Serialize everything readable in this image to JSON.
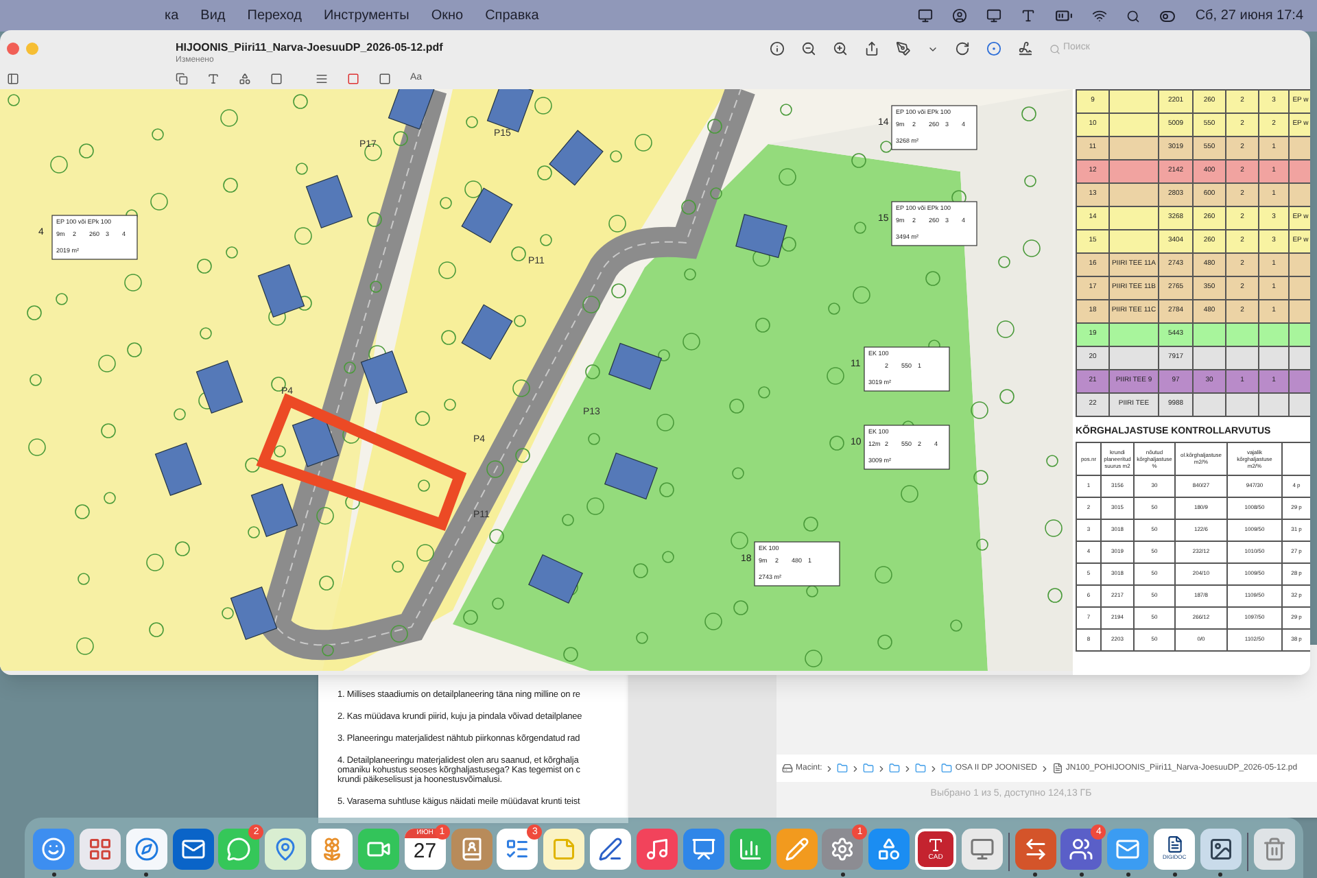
{
  "menu_bar": {
    "menus": [
      "ка",
      "Вид",
      "Переход",
      "Инструменты",
      "Окно",
      "Справка"
    ],
    "clock": "Сб, 27 июня 17:4"
  },
  "preview_window": {
    "title": "HIJOONIS_Piiri11_Narva-JoesuuDP_2026-05-12.pdf",
    "subtitle": "Изменено",
    "search": {
      "placeholder": "Поиск"
    },
    "font_button": "Aa",
    "map": {
      "plot_labels": [
        "P17",
        "P15",
        "P11",
        "P13",
        "P4",
        "P4",
        "P11"
      ],
      "lot_boxes": [
        {
          "num": "4",
          "header": "EP 100 või EPk 100",
          "cells": [
            "9m",
            "2",
            "260",
            "3",
            "4"
          ],
          "area": "2019 m²"
        },
        {
          "num": "14",
          "header": "EP 100 või EPk 100",
          "cells": [
            "9m",
            "2",
            "260",
            "3",
            "4"
          ],
          "area": "3268 m²"
        },
        {
          "num": "15",
          "header": "EP 100 või EPk 100",
          "cells": [
            "9m",
            "2",
            "260",
            "3",
            "4"
          ],
          "area": "3494 m²"
        },
        {
          "num": "11",
          "header": "EK 100",
          "cells": [
            "",
            "2",
            "550",
            "1",
            ""
          ],
          "area": "3019 m²"
        },
        {
          "num": "10",
          "header": "EK 100",
          "cells": [
            "12m",
            "2",
            "550",
            "2",
            "4"
          ],
          "area": "3009 m²"
        },
        {
          "num": "18",
          "header": "EK 100",
          "cells": [
            "9m",
            "2",
            "480",
            "1",
            ""
          ],
          "area": "2743 m²"
        }
      ]
    },
    "plot_table": {
      "rows": [
        {
          "cells": [
            "9",
            "",
            "2201",
            "260",
            "2",
            "3",
            "EP w"
          ],
          "color": "#f8f3a2"
        },
        {
          "cells": [
            "10",
            "",
            "5009",
            "550",
            "2",
            "2",
            "EP w"
          ],
          "color": "#f8f3a2"
        },
        {
          "cells": [
            "11",
            "",
            "3019",
            "550",
            "2",
            "1",
            ""
          ],
          "color": "#ecd3a5"
        },
        {
          "cells": [
            "12",
            "",
            "2142",
            "400",
            "2",
            "1",
            ""
          ],
          "color": "#f1a3a0"
        },
        {
          "cells": [
            "13",
            "",
            "2803",
            "600",
            "2",
            "1",
            ""
          ],
          "color": "#ecd3a5"
        },
        {
          "cells": [
            "14",
            "",
            "3268",
            "260",
            "2",
            "3",
            "EP w"
          ],
          "color": "#f8f3a2"
        },
        {
          "cells": [
            "15",
            "",
            "3404",
            "260",
            "2",
            "3",
            "EP w"
          ],
          "color": "#f8f3a2"
        },
        {
          "cells": [
            "16",
            "PIIRI TEE 11A",
            "2743",
            "480",
            "2",
            "1",
            ""
          ],
          "color": "#ecd3a5"
        },
        {
          "cells": [
            "17",
            "PIIRI TEE 11B",
            "2765",
            "350",
            "2",
            "1",
            ""
          ],
          "color": "#ecd3a5"
        },
        {
          "cells": [
            "18",
            "PIIRI TEE 11C",
            "2784",
            "480",
            "2",
            "1",
            ""
          ],
          "color": "#ecd3a5"
        },
        {
          "cells": [
            "19",
            "",
            "5443",
            "",
            "",
            "",
            ""
          ],
          "color": "#a8f59c"
        },
        {
          "cells": [
            "20",
            "",
            "7917",
            "",
            "",
            "",
            ""
          ],
          "color": "#e2e2e2"
        },
        {
          "cells": [
            "21",
            "PIIRI TEE 9",
            "97",
            "30",
            "1",
            "1",
            ""
          ],
          "color": "#b98bc9"
        },
        {
          "cells": [
            "22",
            "PIIRI TEE",
            "9988",
            "",
            "",
            "",
            ""
          ],
          "color": "#e2e2e2"
        }
      ]
    },
    "greenery_table": {
      "title": "KÕRGHALJASTUSE KONTROLLARVUTUS",
      "columns": [
        "pos.nr",
        "krundi planeeritud suurus m2",
        "nõutud kõrghaljastuse %",
        "ol.kõrghaljastuse m2/%",
        "vajalik kõrghaljastuse m2/%"
      ],
      "rows": [
        [
          "1",
          "3156",
          "30",
          "840/27",
          "947/30",
          "4 p"
        ],
        [
          "2",
          "3015",
          "50",
          "180/9",
          "1008/50",
          "29 p"
        ],
        [
          "3",
          "3018",
          "50",
          "122/6",
          "1009/50",
          "31 p"
        ],
        [
          "4",
          "3019",
          "50",
          "232/12",
          "1010/50",
          "27 p"
        ],
        [
          "5",
          "3018",
          "50",
          "204/10",
          "1009/50",
          "28 p"
        ],
        [
          "6",
          "2217",
          "50",
          "187/8",
          "1109/50",
          "32 p"
        ],
        [
          "7",
          "2194",
          "50",
          "266/12",
          "1097/50",
          "29 p"
        ],
        [
          "8",
          "2203",
          "50",
          "0/0",
          "1102/50",
          "38 p"
        ]
      ]
    }
  },
  "document": {
    "paragraphs": [
      "1. Millises staadiumis on detailplaneering täna ning milline on re",
      "2. Kas müüdava krundi piirid, kuju ja pindala võivad detailplanee",
      "3. Planeeringu materjalidest nähtub piirkonnas kõrgendatud rad",
      "4. Detailplaneeringu materjalidest olen aru saanud, et kõrghalja\nomaniku kohustus seoses kõrghaljastusega? Kas tegemist on c\nkrundi päikeselisust ja hoonestusvõimalusi.",
      "5. Varasema suhtluse käigus näidati meile müüdavat krunti teist"
    ]
  },
  "finder": {
    "path": [
      {
        "kind": "disk",
        "label": "Macint:"
      },
      {
        "kind": "folder"
      },
      {
        "kind": "folder"
      },
      {
        "kind": "folder"
      },
      {
        "kind": "folder"
      },
      {
        "kind": "folder",
        "label": "OSA II DP JOONISED"
      },
      {
        "kind": "file",
        "label": "JN100_POHIJOONIS_Piiri11_Narva-JoesuuDP_2026-05-12.pd"
      }
    ],
    "status": "Выбрано 1 из 5, доступно 124,13 ГБ"
  },
  "dock": {
    "apps": [
      {
        "kind": "finder",
        "running": true
      },
      {
        "kind": "launchpad",
        "running": false
      },
      {
        "kind": "safari",
        "running": true
      },
      {
        "kind": "outlook",
        "running": false
      },
      {
        "kind": "messages",
        "running": false,
        "badge": "2"
      },
      {
        "kind": "maps",
        "running": false
      },
      {
        "kind": "photos",
        "running": false
      },
      {
        "kind": "facetime",
        "running": false
      },
      {
        "kind": "calendar",
        "running": false,
        "badge": "1",
        "month": "ИЮН",
        "day": "27"
      },
      {
        "kind": "contacts",
        "running": false
      },
      {
        "kind": "reminders",
        "running": false,
        "badge": "3"
      },
      {
        "kind": "notes",
        "running": false
      },
      {
        "kind": "freeform",
        "running": false
      },
      {
        "kind": "music",
        "running": false
      },
      {
        "kind": "keynote",
        "running": false
      },
      {
        "kind": "numbers",
        "running": false
      },
      {
        "kind": "pages",
        "running": false
      },
      {
        "kind": "settings",
        "running": true,
        "badge": "1"
      },
      {
        "kind": "appstore",
        "running": false
      },
      {
        "kind": "autocad",
        "running": false,
        "caption": "CAD"
      },
      {
        "kind": "screen",
        "running": false
      },
      {
        "kind": "separator"
      },
      {
        "kind": "remote",
        "running": true
      },
      {
        "kind": "teams",
        "running": true,
        "badge": "4"
      },
      {
        "kind": "mail",
        "running": true
      },
      {
        "kind": "digidoc",
        "running": true,
        "caption": "DIGIDOC"
      },
      {
        "kind": "preview",
        "running": true
      },
      {
        "kind": "separator"
      },
      {
        "kind": "trash",
        "running": false
      }
    ]
  }
}
